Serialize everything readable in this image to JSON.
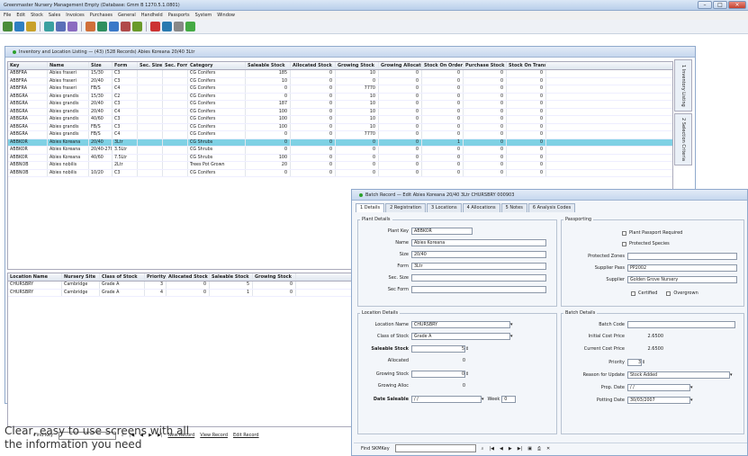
{
  "app_title": "Greenmaster Nursery Management Empty (Database: Gmm B 1270.5.1.0801)",
  "menu": [
    "File",
    "Edit",
    "Stock",
    "Sales",
    "Invoices",
    "Purchases",
    "General",
    "Handheld",
    "Passports",
    "System",
    "Window"
  ],
  "listing": {
    "title": "Inventory and Location Listing — (43) (528 Records) Abies Koreana 20/40 3Ltr",
    "columns": [
      "Key",
      "Name",
      "Size",
      "Form",
      "Sec. Size",
      "Sec. Form",
      "Category",
      "Saleable Stock",
      "Allocated Stock",
      "Growing Stock",
      "Growing Allocated",
      "Stock On Order",
      "Purchase Stock",
      "Stock On Transit"
    ],
    "rows": [
      [
        "ABBFRA",
        "Abies fraseri",
        "15/30",
        "C3",
        "",
        "",
        "CG Conifers",
        "185",
        "0",
        "10",
        "0",
        "0",
        "0",
        "0"
      ],
      [
        "ABBFRA",
        "Abies fraseri",
        "20/40",
        "C3",
        "",
        "",
        "CG Conifers",
        "10",
        "0",
        "0",
        "0",
        "0",
        "0",
        "0"
      ],
      [
        "ABBFRA",
        "Abies fraseri",
        "FB/S",
        "C4",
        "",
        "",
        "CG Conifers",
        "0",
        "0",
        "7770",
        "0",
        "0",
        "0",
        "0"
      ],
      [
        "ABBGRA",
        "Abies grandis",
        "15/30",
        "C2",
        "",
        "",
        "CG Conifers",
        "0",
        "0",
        "10",
        "0",
        "0",
        "0",
        "0"
      ],
      [
        "ABBGRA",
        "Abies grandis",
        "20/40",
        "C3",
        "",
        "",
        "CG Conifers",
        "187",
        "0",
        "10",
        "0",
        "0",
        "0",
        "0"
      ],
      [
        "ABBGRA",
        "Abies grandis",
        "20/40",
        "C4",
        "",
        "",
        "CG Conifers",
        "100",
        "0",
        "10",
        "0",
        "0",
        "0",
        "0"
      ],
      [
        "ABBGRA",
        "Abies grandis",
        "40/60",
        "C3",
        "",
        "",
        "CG Conifers",
        "100",
        "0",
        "10",
        "0",
        "0",
        "0",
        "0"
      ],
      [
        "ABBGRA",
        "Abies grandis",
        "FB/S",
        "C3",
        "",
        "",
        "CG Conifers",
        "100",
        "0",
        "10",
        "0",
        "0",
        "0",
        "0"
      ],
      [
        "ABBGRA",
        "Abies grandis",
        "FB/S",
        "C4",
        "",
        "",
        "CG Conifers",
        "0",
        "0",
        "7770",
        "0",
        "0",
        "0",
        "0"
      ],
      [
        "ABBKOR",
        "Abies Koreana",
        "20/40",
        "3Ltr",
        "",
        "",
        "CG Shrubs",
        "0",
        "0",
        "0",
        "0",
        "1",
        "0",
        "0"
      ],
      [
        "ABBKOR",
        "Abies Koreana",
        "20/40-270",
        "3.5Ltr",
        "",
        "",
        "CG Shrubs",
        "0",
        "0",
        "0",
        "0",
        "0",
        "0",
        "0"
      ],
      [
        "ABBKOR",
        "Abies Koreana",
        "40/60",
        "7.5Ltr",
        "",
        "",
        "CG Shrubs",
        "100",
        "0",
        "0",
        "0",
        "0",
        "0",
        "0"
      ],
      [
        "ABBNOB",
        "Abies nobilis",
        "",
        "2Ltr",
        "",
        "",
        "Trees Pot Grown",
        "20",
        "0",
        "0",
        "0",
        "0",
        "0",
        "0"
      ],
      [
        "ABBNOB",
        "Abies nobilis",
        "10/20",
        "C3",
        "",
        "",
        "CG Conifers",
        "0",
        "0",
        "0",
        "0",
        "0",
        "0",
        "0"
      ]
    ],
    "selected_row": 9,
    "loc_columns": [
      "Location Name",
      "Nursery Site",
      "Class of Stock",
      "Priority",
      "Allocated Stock",
      "Saleable Stock",
      "Growing Stock"
    ],
    "loc_rows": [
      [
        "CHURSBRY",
        "Cambridge",
        "Grade A",
        "3",
        "0",
        "5",
        "0"
      ],
      [
        "CHURSBRY",
        "Cambridge",
        "Grade A",
        "4",
        "0",
        "1",
        "0"
      ]
    ],
    "side_tabs": [
      "1 Inventory Listing",
      "2 Selection Criteria"
    ],
    "find_label": "Find Key",
    "nav_buttons": [
      "New Record",
      "View Record",
      "Edit Record"
    ]
  },
  "batch": {
    "title": "Batch Record — Edit Abies Koreana 20/40 3Ltr  CHURSBRY 000903",
    "tabs": [
      "1 Details",
      "2 Registration",
      "3 Locations",
      "4 Allocations",
      "5 Notes",
      "6 Analysis Codes"
    ],
    "plant_details": {
      "legend": "Plant Details",
      "plant_key": "ABBKOR",
      "name": "Abies Koreana",
      "size": "20/40",
      "form": "3Ltr",
      "sec_size": "",
      "sec_form": ""
    },
    "labels": {
      "plant_key": "Plant Key",
      "name": "Name",
      "size": "Size",
      "form": "Form",
      "sec_size": "Sec. Size",
      "sec_form": "Sec Form"
    },
    "passporting": {
      "legend": "Passporting",
      "chk1": "Plant Passport Required",
      "chk2": "Protected Species",
      "protected_zones_label": "Protected Zones",
      "protected_zones": "",
      "supplier_pass_label": "Supplier Pass",
      "supplier_pass": "PP2002",
      "supplier_label": "Supplier",
      "supplier": "Golden Grove Nursery",
      "certified": "Certified",
      "overgrown": "Overgrown"
    },
    "location": {
      "legend": "Location Details",
      "loc_name_label": "Location Name",
      "loc_name": "CHURSBRY",
      "class_label": "Class of Stock",
      "class": "Grade A",
      "saleable_label": "Saleable Stock",
      "saleable": "5",
      "allocated_label": "Allocated",
      "allocated": "0",
      "growing_label": "Growing Stock",
      "growing": "0",
      "growing_alloc_label": "Growing Alloc",
      "growing_alloc": "0",
      "date_label": "Date Saleable",
      "date": "/ /",
      "week_label": "Week",
      "week": "0"
    },
    "batch_details": {
      "legend": "Batch Details",
      "code_label": "Batch Code",
      "code": "",
      "initial_label": "Initial Cost Price",
      "initial": "2.6500",
      "current_label": "Current Cost Price",
      "current": "2.6500",
      "priority_label": "Priority",
      "priority": "3",
      "reason_label": "Reason for Update",
      "reason": "Stock Added",
      "prop_label": "Prop. Date",
      "prop": "/ /",
      "potting_label": "Potting Date",
      "potting": "30/03/2007"
    },
    "find_label": "Find SKMKey"
  },
  "caption_line1": "Clear, easy to use screens with all",
  "caption_line2": "the information you need"
}
